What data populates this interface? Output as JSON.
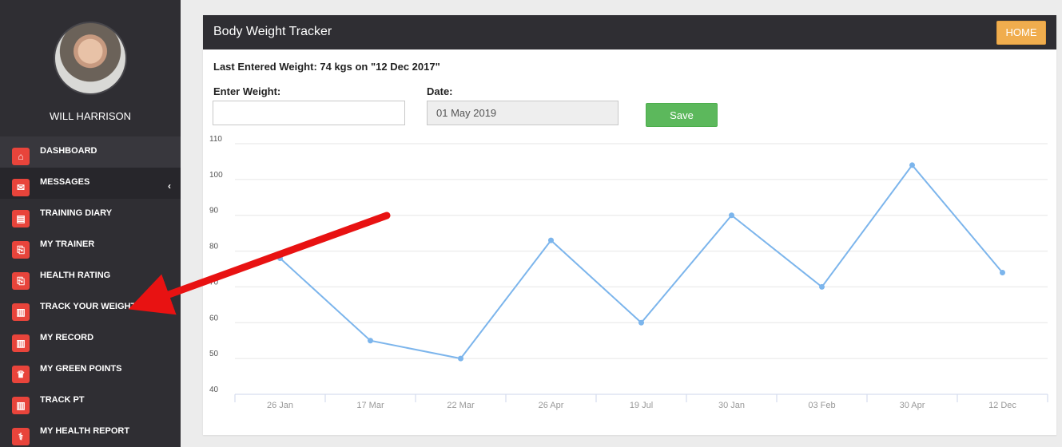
{
  "user": {
    "name": "WILL HARRISON"
  },
  "nav": {
    "items": [
      {
        "label": "DASHBOARD",
        "icon": "home-icon",
        "glyph": "⌂"
      },
      {
        "label": "MESSAGES",
        "icon": "envelope-icon",
        "glyph": "✉"
      },
      {
        "label": "TRAINING DIARY",
        "icon": "book-icon",
        "glyph": "▤"
      },
      {
        "label": "MY TRAINER",
        "icon": "pdf-icon",
        "glyph": "⎘"
      },
      {
        "label": "HEALTH RATING",
        "icon": "pdf-icon",
        "glyph": "⎘"
      },
      {
        "label": "TRACK YOUR WEIGHT",
        "icon": "bar-chart-icon",
        "glyph": "▥"
      },
      {
        "label": "MY RECORD",
        "icon": "bar-chart-icon",
        "glyph": "▥"
      },
      {
        "label": "MY GREEN POINTS",
        "icon": "trophy-icon",
        "glyph": "♛"
      },
      {
        "label": "TRACK PT",
        "icon": "bar-chart-icon",
        "glyph": "▥"
      },
      {
        "label": "MY HEALTH REPORT",
        "icon": "stethoscope-icon",
        "glyph": "⚕"
      }
    ],
    "messages_chevron": "‹"
  },
  "panel": {
    "title": "Body Weight Tracker",
    "home_label": "HOME",
    "last_entered": "Last Entered Weight: 74 kgs on \"12 Dec 2017\"",
    "weight_label": "Enter Weight:",
    "weight_value": "",
    "date_label": "Date:",
    "date_value": "01 May 2019",
    "save_label": "Save"
  },
  "colors": {
    "sidebar": "#2f2e33",
    "icon_red": "#e8443b",
    "line": "#7cb5ec",
    "home": "#f0ad4e",
    "save": "#5cb85c",
    "arrow": "#e81212"
  },
  "chart_data": {
    "type": "line",
    "categories": [
      "26 Jan",
      "17 Mar",
      "22 Mar",
      "26 Apr",
      "19 Jul",
      "30 Jan",
      "03 Feb",
      "30 Apr",
      "12 Dec"
    ],
    "values": [
      78,
      55,
      50,
      83,
      60,
      90,
      70,
      104,
      74
    ],
    "yticks": [
      "40",
      "50",
      "60",
      "70",
      "80",
      "90",
      "100",
      "110"
    ],
    "ylim": [
      40,
      110
    ],
    "title": "",
    "xlabel": "",
    "ylabel": "",
    "grid": true
  }
}
